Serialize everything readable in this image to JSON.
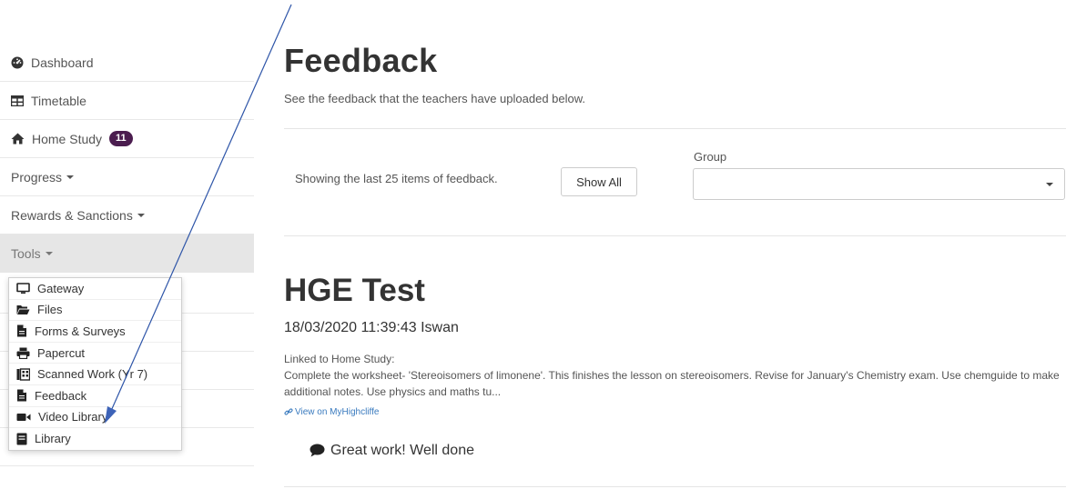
{
  "sidebar": {
    "items": [
      {
        "label": "Dashboard",
        "icon": "dashboard-icon"
      },
      {
        "label": "Timetable",
        "icon": "table-icon"
      },
      {
        "label": "Home Study",
        "icon": "home-icon",
        "badge": "11"
      },
      {
        "label": "Progress",
        "dropdown": true
      },
      {
        "label": "Rewards & Sanctions",
        "dropdown": true
      },
      {
        "label": "Tools",
        "dropdown": true,
        "active": true
      }
    ],
    "tools_menu": [
      {
        "label": "Gateway",
        "icon": "monitor-icon"
      },
      {
        "label": "Files",
        "icon": "folder-open-icon"
      },
      {
        "label": "Forms & Surveys",
        "icon": "file-icon"
      },
      {
        "label": "Papercut",
        "icon": "printer-icon"
      },
      {
        "label": "Scanned Work (Yr 7)",
        "icon": "scanner-icon"
      },
      {
        "label": "Feedback",
        "icon": "file-icon"
      },
      {
        "label": "Video Library",
        "icon": "video-camera-icon"
      },
      {
        "label": "Library",
        "icon": "book-icon"
      }
    ]
  },
  "main": {
    "title": "Feedback",
    "subtitle": "See the feedback that the teachers have uploaded below.",
    "showing_text": "Showing the last 25 items of feedback.",
    "show_all_label": "Show All",
    "group_label": "Group",
    "group_value": "",
    "item": {
      "title": "HGE Test",
      "meta": "18/03/2020 11:39:43 Iswan",
      "linked_label": "Linked to Home Study:",
      "description": "Complete the worksheet- 'Stereoisomers of limonene'. This finishes the lesson on stereoisomers. Revise for January's Chemistry exam. Use chemguide to make additional notes. Use physics and maths tu...",
      "link_text": "View on MyHighcliffe",
      "comment": "Great work! Well done"
    }
  },
  "colors": {
    "badge": "#4b1d4f",
    "link": "#3a7bbf",
    "arrow": "#2e55a8"
  }
}
